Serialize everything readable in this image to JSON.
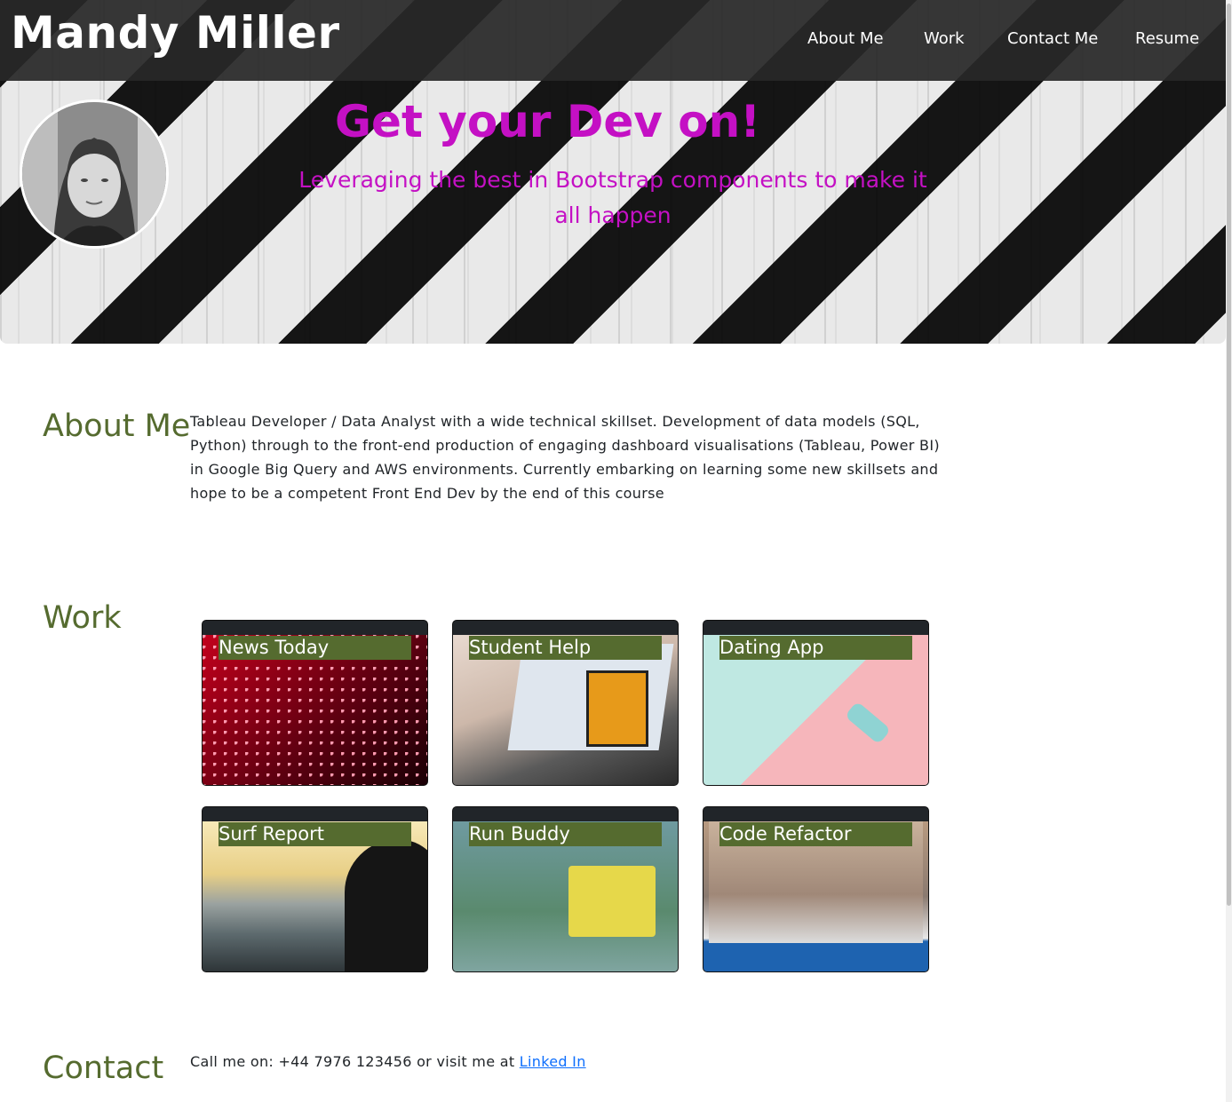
{
  "header": {
    "brand": "Mandy Miller",
    "nav": [
      "About Me",
      "Work",
      "Contact Me",
      "Resume"
    ]
  },
  "hero": {
    "title": "Get your Dev on!",
    "subtitle": "Leveraging the best in Bootstrap components to make it all happen"
  },
  "about": {
    "heading": "About Me",
    "text": "Tableau Developer / Data Analyst with a wide technical skillset. Development of data models (SQL, Python) through to the front-end production of engaging dashboard visualisations (Tableau, Power BI) in Google Big Query and AWS environments. Currently embarking on learning some new skillsets and hope to be a competent Front End Dev by the end of this course"
  },
  "work": {
    "heading": "Work",
    "projects": [
      "News Today",
      "Student Help",
      "Dating App",
      "Surf Report",
      "Run Buddy",
      "Code Refactor"
    ]
  },
  "contact": {
    "heading": "Contact",
    "text": "Call me on: +44 7976 123456 or visit me at ",
    "link_label": "Linked In"
  },
  "colors": {
    "accent": "#c410c4",
    "heading": "#556b2f",
    "label_bg": "#556b2f",
    "navbar": "#282828"
  }
}
